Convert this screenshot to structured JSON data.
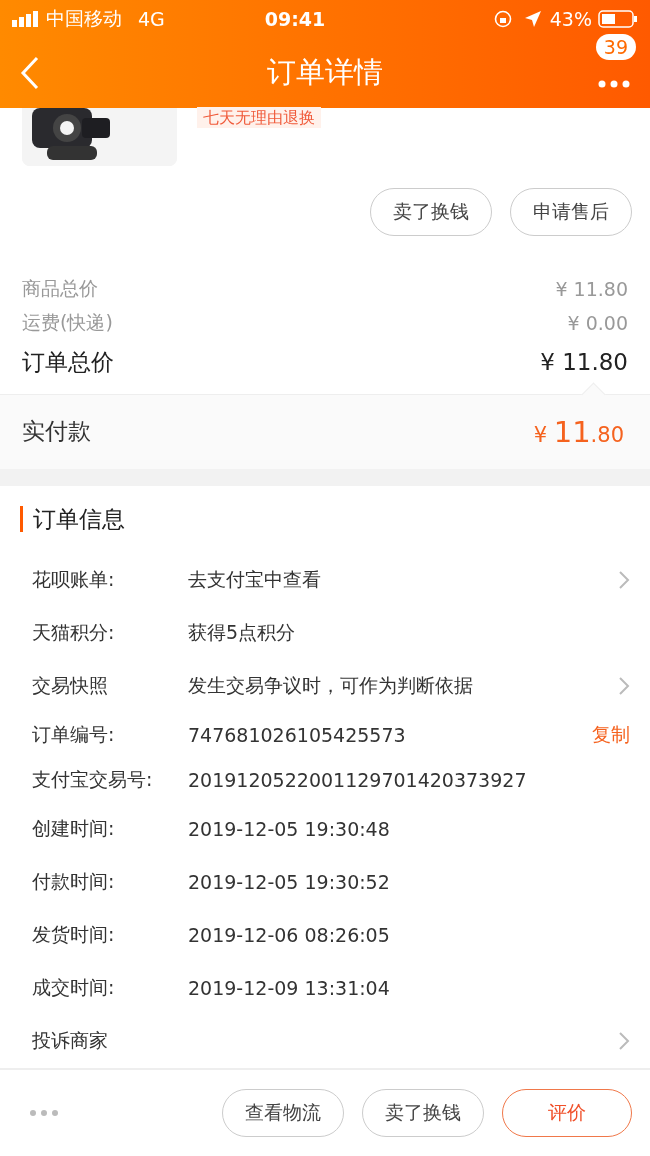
{
  "status_bar": {
    "carrier": "中国移动",
    "network": "4G",
    "time": "09:41",
    "battery": "43%"
  },
  "nav": {
    "title": "订单详情",
    "badge": "39"
  },
  "product": {
    "tag": "七天无理由退换"
  },
  "item_actions": [
    "卖了换钱",
    "申请售后"
  ],
  "price_rows": [
    {
      "label": "商品总价",
      "value": "¥ 11.80",
      "kind": "minor"
    },
    {
      "label": "运费(快递)",
      "value": "¥ 0.00",
      "kind": "minor"
    },
    {
      "label": "订单总价",
      "value": "¥ 11.80",
      "kind": "total"
    }
  ],
  "paid": {
    "label": "实付款",
    "currency": "¥",
    "integer": "11",
    "decimal": ".80"
  },
  "order_info": {
    "title": "订单信息",
    "rows": [
      {
        "label": "花呗账单:",
        "value": "去支付宝中查看",
        "kind": "link"
      },
      {
        "label": "天猫积分:",
        "value": "获得5点积分",
        "kind": "plain"
      },
      {
        "label": "交易快照",
        "value": "发生交易争议时，可作为判断依据",
        "kind": "link"
      },
      {
        "label": "订单编号:",
        "value": "747681026105425573",
        "kind": "copy",
        "action": "复制"
      },
      {
        "label": "支付宝交易号:",
        "value": "2019120522001129701420373927",
        "kind": "plain"
      },
      {
        "label": "创建时间:",
        "value": "2019-12-05 19:30:48",
        "kind": "plain"
      },
      {
        "label": "付款时间:",
        "value": "2019-12-05 19:30:52",
        "kind": "plain"
      },
      {
        "label": "发货时间:",
        "value": "2019-12-06 08:26:05",
        "kind": "plain"
      },
      {
        "label": "成交时间:",
        "value": "2019-12-09 13:31:04",
        "kind": "plain"
      },
      {
        "label": "投诉商家",
        "kind": "link"
      }
    ]
  },
  "bottom_actions": [
    {
      "label": "查看物流",
      "kind": "normal"
    },
    {
      "label": "卖了换钱",
      "kind": "normal"
    },
    {
      "label": "评价",
      "kind": "primary"
    }
  ]
}
